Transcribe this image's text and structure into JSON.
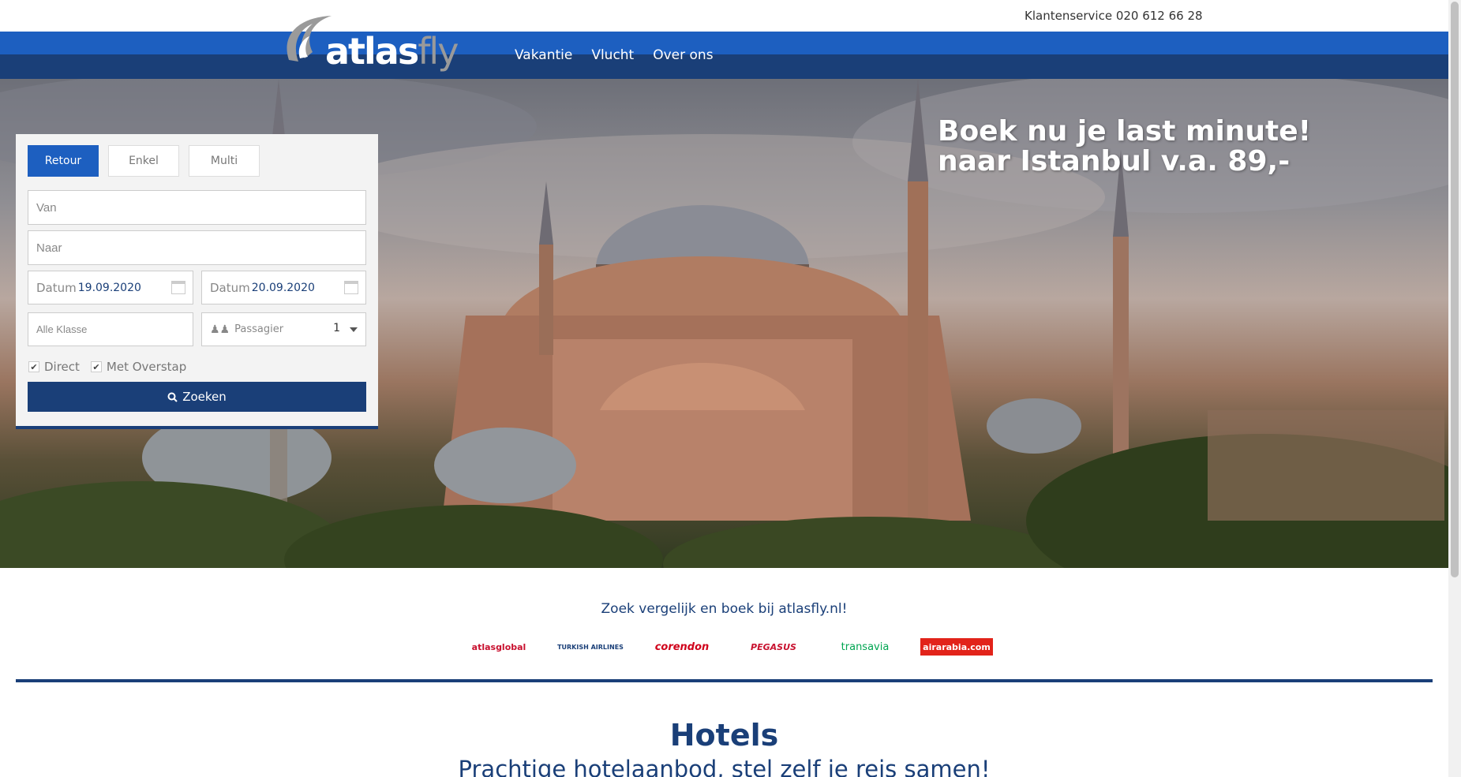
{
  "header": {
    "customer_service": "Klantenservice 020 612 66 28",
    "logo_atlas": "atlas",
    "logo_fly": "fly"
  },
  "nav": {
    "items": [
      {
        "label": "Vakantie"
      },
      {
        "label": "Vlucht"
      },
      {
        "label": "Over ons"
      }
    ]
  },
  "hero": {
    "headline": "Boek nu je last minute! naar Istanbul v.a. 89,-"
  },
  "search": {
    "tabs": [
      {
        "label": "Retour",
        "active": true
      },
      {
        "label": "Enkel",
        "active": false
      },
      {
        "label": "Multi",
        "active": false
      }
    ],
    "from_placeholder": "Van",
    "to_placeholder": "Naar",
    "date_label": "Datum",
    "depart_date": "19.09.2020",
    "return_date": "20.09.2020",
    "class_placeholder": "Alle Klasse",
    "passengers_label": "Passagier",
    "passengers_value": "1",
    "option_direct": "Direct",
    "option_stopover": "Met Overstap",
    "search_button": "Zoeken"
  },
  "partners": {
    "tagline": "Zoek vergelijk en boek bij atlasfly.nl!",
    "airlines": [
      {
        "label": "atlasglobal",
        "color": "#c8102e"
      },
      {
        "label": "TURKISH AIRLINES",
        "color": "#c8102e"
      },
      {
        "label": "corendon",
        "color": "#d0021b"
      },
      {
        "label": "PEGASUS",
        "color": "#f5a623"
      },
      {
        "label": "transavia",
        "color": "#00a551"
      },
      {
        "label": "airarabia.com",
        "color": "#e2231a"
      }
    ]
  },
  "hotels": {
    "title": "Hotels",
    "subtitle": "Prachtige hotelaanbod, stel zelf je reis samen!"
  },
  "colors": {
    "primary": "#1d5fc0",
    "dark_blue": "#1a3f78"
  }
}
